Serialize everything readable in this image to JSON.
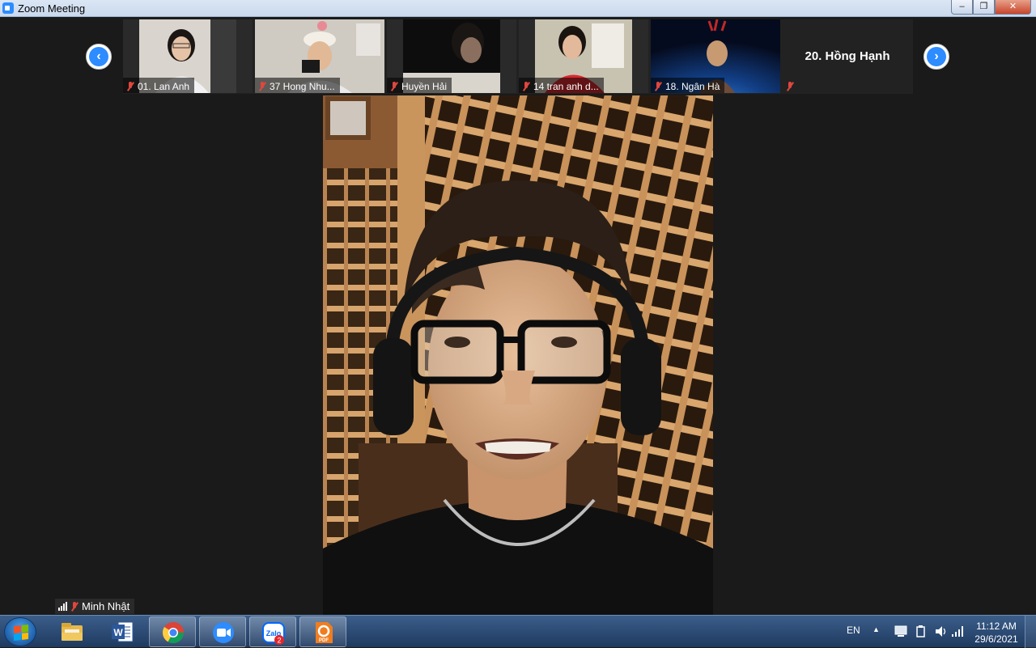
{
  "window": {
    "title": "Zoom Meeting"
  },
  "thumbnails": [
    {
      "name": "01. Lan Anh"
    },
    {
      "name": "37 Hong Nhu..."
    },
    {
      "name": "Huyền Hải"
    },
    {
      "name": "14 tran anh d..."
    },
    {
      "name": "18. Ngân Hà"
    }
  ],
  "name_only_participant": {
    "name": "20. Hồng Hạnh"
  },
  "active_speaker": {
    "name": "Minh Nhật"
  },
  "taskbar": {
    "badges": {
      "zalo": "2"
    },
    "icon_labels": {
      "zalo": "Zalo",
      "pdf": "PDF"
    },
    "language": "EN",
    "time": "11:12 AM",
    "date": "29/6/2021"
  },
  "icons": [
    "zoom-icon",
    "chevron-left-icon",
    "chevron-right-icon",
    "muted-mic-icon",
    "signal-icon",
    "windows-start-icon",
    "file-explorer-icon",
    "word-icon",
    "chrome-icon",
    "zalo-icon",
    "pdf-icon",
    "volume-icon",
    "network-icon"
  ],
  "colors": {
    "zoom_blue": "#2d8cff",
    "muted_red": "#e0473e",
    "background": "#1a1a1a"
  }
}
